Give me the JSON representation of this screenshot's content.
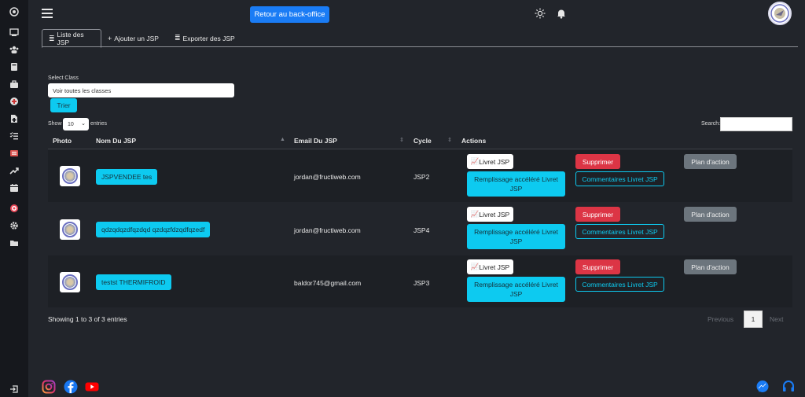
{
  "topbar": {
    "backoffice_label": "Retour au back-office"
  },
  "tabs": [
    {
      "label": "Liste des JSP",
      "icon": "list-icon"
    },
    {
      "label": "Ajouter un JSP",
      "icon": "plus-icon"
    },
    {
      "label": "Exporter des JSP",
      "icon": "list-icon"
    }
  ],
  "filter": {
    "label": "Select Class",
    "selected": "Voir toutes les classes",
    "button": "Trier"
  },
  "table_controls": {
    "show": "Show",
    "page_size": "10",
    "entries": "entries",
    "search_label": "Search:"
  },
  "table": {
    "headers": [
      "Photo",
      "Nom Du JSP",
      "Email Du JSP",
      "Cycle",
      "Actions"
    ],
    "rows": [
      {
        "name": "JSPVENDEE tes",
        "email": "jordan@fructiweb.com",
        "cycle": "JSP2"
      },
      {
        "name": "qdzqdqzdfqzdqd qzdqzfdzqdfqzedf",
        "email": "jordan@fructiweb.com",
        "cycle": "JSP4"
      },
      {
        "name": "testst THERMIFROID",
        "email": "baldor745@gmail.com",
        "cycle": "JSP3"
      }
    ],
    "actions": {
      "livret": "Livret JSP",
      "remplissage": "Remplissage accéléré Livret JSP",
      "supprimer": "Supprimer",
      "commentaires": "Commentaires Livret JSP",
      "plan": "Plan d'action"
    }
  },
  "footer": {
    "showing": "Showing 1 to 3 of 3 entries",
    "previous": "Previous",
    "page": "1",
    "next": "Next"
  },
  "colors": {
    "primary": "#1a7cf5",
    "info": "#0dcaf0",
    "danger": "#dc3545",
    "secondary": "#6c757d",
    "background": "#22252b",
    "sidebar": "#16181d"
  }
}
